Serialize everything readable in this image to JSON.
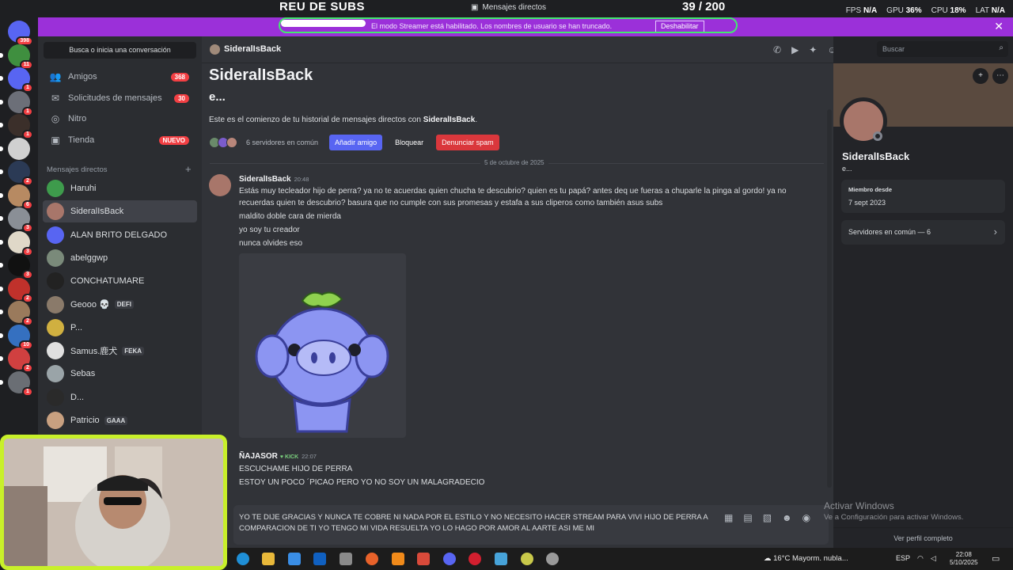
{
  "overlay": {
    "title": "REU DE SUBS",
    "count": "39  / 200",
    "window_title": "Mensajes directos",
    "stats": [
      {
        "label": "FPS",
        "value": "N/A"
      },
      {
        "label": "GPU",
        "value": "36%"
      },
      {
        "label": "CPU",
        "value": "18%"
      },
      {
        "label": "LAT",
        "value": "N/A"
      }
    ]
  },
  "banner": {
    "text": "El modo Streamer está habilitado. Los nombres de usuario se han truncado.",
    "button": "Deshabilitar",
    "close_icon": "close-icon"
  },
  "servers": [
    {
      "badge": "398",
      "color": "#5865f2"
    },
    {
      "badge": "11",
      "color": "#3f8f3f"
    },
    {
      "badge": "1",
      "color": "#5865f2"
    },
    {
      "badge": "1",
      "color": "#6c6f78"
    },
    {
      "badge": "1",
      "color": "#3b2f2a"
    },
    {
      "badge": "",
      "color": "#d0d0d0"
    },
    {
      "badge": "2",
      "color": "#2b3a55"
    },
    {
      "badge": "6",
      "color": "#b78a62"
    },
    {
      "badge": "3",
      "color": "#8a8f96"
    },
    {
      "badge": "3",
      "color": "#e0d8c8"
    },
    {
      "badge": "3",
      "color": "#111111"
    },
    {
      "badge": "2",
      "color": "#c0312b"
    },
    {
      "badge": "2",
      "color": "#9a7a5c"
    },
    {
      "badge": "10",
      "color": "#3570c0"
    },
    {
      "badge": "2",
      "color": "#d04040"
    },
    {
      "badge": "1",
      "color": "#6a6e74"
    }
  ],
  "sidebar": {
    "search": "Busca o inicia una conversación",
    "nav": [
      {
        "label": "Amigos",
        "count": "368",
        "icon": "friends-icon",
        "glyph": "👥"
      },
      {
        "label": "Solicitudes de mensajes",
        "count": "30",
        "icon": "mail-icon",
        "glyph": "✉"
      },
      {
        "label": "Nitro",
        "count": "",
        "icon": "nitro-icon",
        "glyph": "◎"
      },
      {
        "label": "Tienda",
        "count": "NUEVO",
        "icon": "shop-icon",
        "glyph": "▣"
      }
    ],
    "dm_header": "Mensajes directos",
    "dms": [
      {
        "name": "Haruhi",
        "tag": "",
        "color": "#3e9b4c"
      },
      {
        "name": "SideralIsBack",
        "tag": "",
        "color": "#a8766a"
      },
      {
        "name": "ALAN BRITO DELGADO",
        "tag": "",
        "color": "#5865f2"
      },
      {
        "name": "abelggwp",
        "tag": "",
        "color": "#7a8a7a"
      },
      {
        "name": "CONCHATUMARE",
        "tag": "",
        "color": "#222222"
      },
      {
        "name": "Geooo 💀",
        "tag": "DEFI",
        "color": "#8a7a6a"
      },
      {
        "name": "P...",
        "tag": "",
        "color": "#d0b040"
      },
      {
        "name": "Samus.鹿犬",
        "tag": "FEKA",
        "color": "#e0e0e0"
      },
      {
        "name": "Sebas",
        "tag": "",
        "color": "#9aa4a8"
      },
      {
        "name": "D...",
        "tag": "",
        "color": "#2a2a2a"
      },
      {
        "name": "Patricio",
        "tag": "GAAA",
        "color": "#c8a080"
      }
    ]
  },
  "chat": {
    "header_name": "SideralIsBack",
    "big_name": "SideralIsBack",
    "sub_name": "e...",
    "intro_prefix": "Este es el comienzo de tu historial de mensajes directos con ",
    "intro_name": "SideralIsBack",
    "intro_suffix": ".",
    "common_servers": "6 servidores en común",
    "btn_add": "Añadir amigo",
    "btn_block": "Bloquear",
    "btn_spam": "Denunciar spam",
    "date": "5 de octubre de 2025",
    "msg1": {
      "author": "SideralIsBack",
      "time": "20:48",
      "lines": [
        "Estás muy tecleador hijo de perra? ya no te acuerdas quien chucha te descubrio? quien es tu papá? antes deq ue fueras a chuparle la pinga al gordo! ya no",
        "recuerdas quien te descubrio? basura que no cumple con sus promesas y estafa a sus cliperos como también asus subs",
        "maldito doble cara de mierda",
        "yo soy tu creador",
        "nunca olvides eso"
      ]
    },
    "msg2": {
      "author": "ÑAJASOR",
      "badge": "KICK",
      "time": "22:07",
      "lines": [
        "ESCUCHAME HIJO DE PERRA",
        "ESTOY  UN POCO ´PICAO PERO YO NO SOY UN MALAGRADECIO"
      ]
    },
    "composer_text": "YO TE DIJE  GRACIAS Y NUNCA TE COBRE NI NADA POR EL ESTILO Y NO NECESITO HACER STREAM PARA VIVI HIJO DE PERRA A COMPARACION DE TI YO TENGO MI VIDA RESUELTA YO LO HAGO POR AMOR AL AARTE ASI ME MI"
  },
  "search": {
    "placeholder": "Buscar"
  },
  "profile": {
    "name": "SideralIsBack",
    "sub": "e...",
    "member_label": "Miembro desde",
    "member_date": "7 sept 2023",
    "common": "Servidores en común — 6",
    "full_profile": "Ver perfil completo"
  },
  "windows": {
    "activate_title": "Activar Windows",
    "activate_sub": "Ve a Configuración para activar Windows."
  },
  "taskbar": {
    "weather": "16°C  Mayorm. nubla...",
    "lang": "ESP",
    "time": "22:08",
    "date": "5/10/2025"
  }
}
